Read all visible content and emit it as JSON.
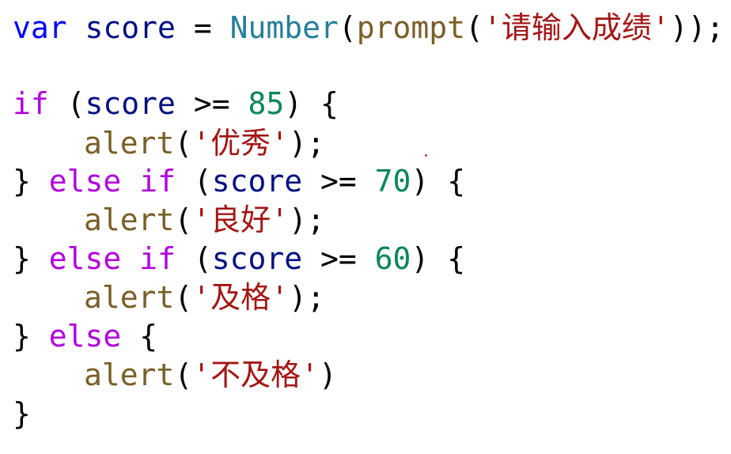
{
  "code": {
    "line1": {
      "kw": "var",
      "var_name": "score",
      "assign": "=",
      "ctor": "Number",
      "open1": "(",
      "fn": "prompt",
      "open2": "(",
      "str": "'请输入成绩'",
      "close": "));"
    },
    "line3": {
      "kw": "if",
      "open": "(",
      "var_name": "score",
      "op": ">=",
      "num": "85",
      "close": ")",
      "brace": "{"
    },
    "line4": {
      "fn": "alert",
      "open": "(",
      "str": "'优秀'",
      "close": ");"
    },
    "line5": {
      "brace_close": "}",
      "kw_else": "else",
      "kw_if": "if",
      "open": "(",
      "var_name": "score",
      "op": ">=",
      "num": "70",
      "close": ")",
      "brace": "{"
    },
    "line6": {
      "fn": "alert",
      "open": "(",
      "str": "'良好'",
      "close": ");"
    },
    "line7": {
      "brace_close": "}",
      "kw_else": "else",
      "kw_if": "if",
      "open": "(",
      "var_name": "score",
      "op": ">=",
      "num": "60",
      "close": ")",
      "brace": "{"
    },
    "line8": {
      "fn": "alert",
      "open": "(",
      "str": "'及格'",
      "close": ");"
    },
    "line9": {
      "brace_close": "}",
      "kw_else": "else",
      "brace": "{"
    },
    "line10": {
      "fn": "alert",
      "open": "(",
      "str": "'不及格'",
      "close": ")"
    },
    "line11": {
      "brace_close": "}"
    }
  },
  "colors": {
    "keyword_decl": "#0000ff",
    "keyword_control": "#af00db",
    "identifier": "#001080",
    "type": "#267f99",
    "function": "#795e26",
    "number": "#098658",
    "string": "#a31515"
  }
}
